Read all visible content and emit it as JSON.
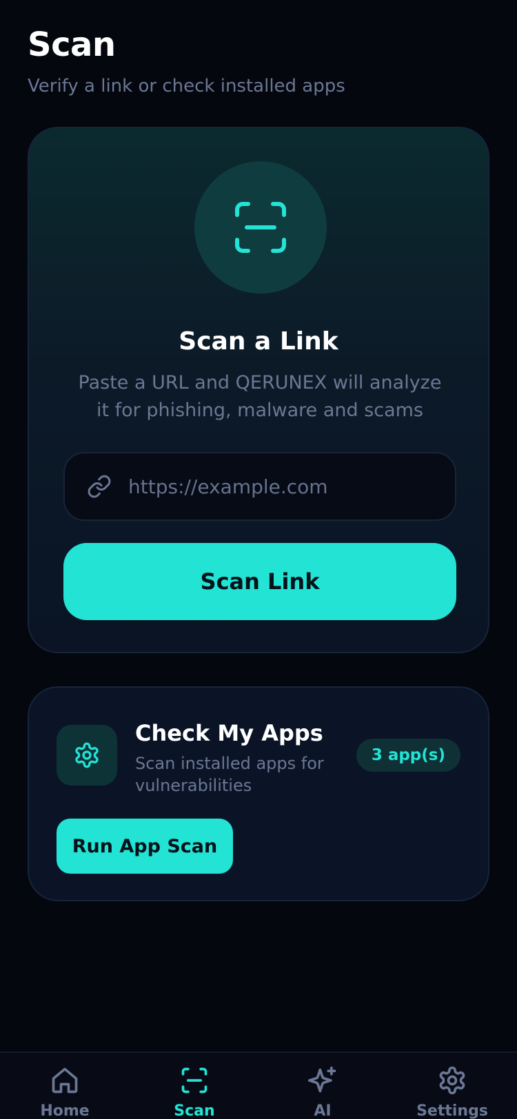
{
  "header": {
    "title": "Scan",
    "subtitle": "Verify a link or check installed apps"
  },
  "link_scan": {
    "icon": "scan-frame-icon",
    "title": "Scan a Link",
    "description": "Paste a URL and QERUNEX will analyze it for phishing, malware and scams",
    "input_placeholder": "https://example.com",
    "input_value": "",
    "button_label": "Scan Link"
  },
  "apps_check": {
    "icon": "gear-icon",
    "title": "Check My Apps",
    "description": "Scan installed apps for vulnerabilities",
    "badge": "3 app(s)",
    "button_label": "Run App Scan"
  },
  "nav": {
    "items": [
      {
        "label": "Home",
        "icon": "home-icon",
        "active": false
      },
      {
        "label": "Scan",
        "icon": "scan-icon",
        "active": true
      },
      {
        "label": "AI",
        "icon": "sparkle-icon",
        "active": false
      },
      {
        "label": "Settings",
        "icon": "settings-icon",
        "active": false
      }
    ]
  },
  "colors": {
    "background": "#05070f",
    "accent": "#22e3d4",
    "muted_text": "#6b7894",
    "card": "#0b1426"
  }
}
